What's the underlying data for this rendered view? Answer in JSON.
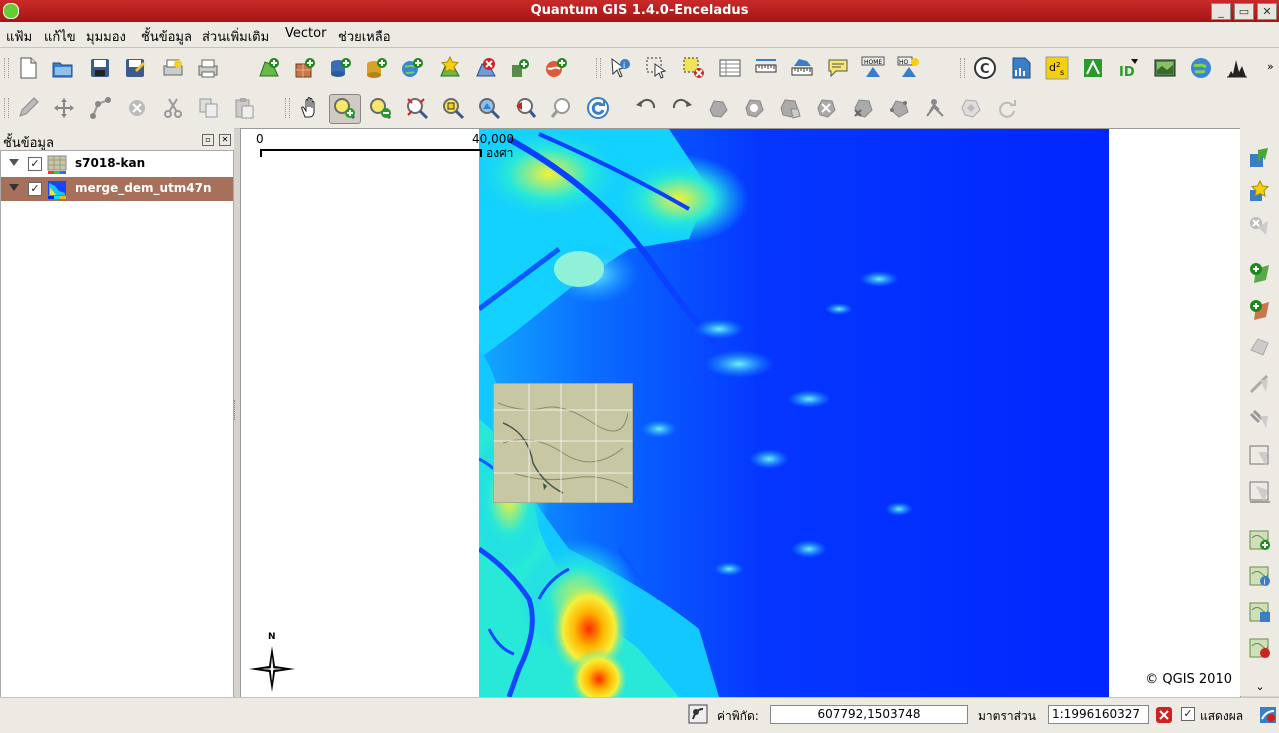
{
  "window": {
    "title": "Quantum GIS 1.4.0-Enceladus",
    "minimize": "_",
    "maximize": "▭",
    "close": "✕"
  },
  "menu": [
    "แฟ้ม",
    "แก้ไข",
    "มุมมอง",
    "ชั้นข้อมูล",
    "ส่วนเพิ่มเติม",
    "Vector",
    "ช่วยเหลือ"
  ],
  "layers_panel": {
    "title": "ชั้นข้อมูล",
    "layers": [
      {
        "name": "s7018-kan",
        "checked": "✓"
      },
      {
        "name": "merge_dem_utm47n",
        "checked": "✓"
      }
    ]
  },
  "map": {
    "scalebar_start": "0",
    "scalebar_end": "40,000",
    "scalebar_unit": "องศา",
    "north_label": "N",
    "copyright": "© QGIS 2010"
  },
  "toolbar_icons": {
    "row1": [
      "new-project-icon",
      "open-project-icon",
      "save-project-icon",
      "save-as-icon",
      "print-composer-icon",
      "print-icon",
      "add-vector-layer-icon",
      "add-raster-layer-icon",
      "add-postgis-layer-icon",
      "add-spatialite-layer-icon",
      "add-wms-layer-icon",
      "new-vector-layer-icon",
      "remove-layer-icon",
      "overview-add-icon",
      "add-wfs-layer-icon",
      "identify-icon",
      "select-features-icon",
      "deselect-icon",
      "attribute-table-icon",
      "measure-line-icon",
      "measure-area-icon",
      "map-tips-icon",
      "home-icon",
      "ho-icon",
      "copyright-icon",
      "export-icon",
      "d2s-icon",
      "georeferencer-icon",
      "gps-icon",
      "raster-icon",
      "globe-icon",
      "histogram-icon"
    ],
    "row2": [
      "toggle-edit-icon",
      "move-feature-icon",
      "node-tool-icon",
      "delete-feature-icon",
      "cut-icon",
      "copy-icon",
      "paste-icon",
      "pan-icon",
      "zoom-in-icon",
      "zoom-out-icon",
      "zoom-full-icon",
      "zoom-selection-icon",
      "zoom-layer-icon",
      "zoom-last-icon",
      "zoom-next-icon",
      "refresh-icon",
      "undo-icon",
      "redo-icon",
      "simplify-icon",
      "add-ring-icon",
      "add-island-icon",
      "delete-ring-icon",
      "delete-part-icon",
      "reshape-icon",
      "split-icon",
      "merge-icon",
      "rotate-icon"
    ]
  },
  "right_toolbar": [
    "add-vector-side-icon",
    "add-raster-side-icon",
    "remove-side-icon",
    "new-layer-side-icon",
    "add-layer-side-icon",
    "edit-side-icon",
    "digitize-side-icon",
    "move-side-icon",
    "node-side-icon",
    "tool-side-icon",
    "map-add-icon",
    "map-info-icon",
    "map-export-icon",
    "map-delete-icon",
    "more-icon"
  ],
  "status": {
    "coord_label": "ค่าพิกัด:",
    "coord_value": "607792,1503748",
    "scale_label": "มาตราส่วน",
    "scale_value": "1:1996160327",
    "render_label": "แสดงผล",
    "render_checked": "✓"
  },
  "colors": {
    "title_bar": "#b11d1d",
    "selection": "#a7705a",
    "dem_low": "#0026ff",
    "dem_mid": "#00e5ff",
    "dem_high": "#ff2a00"
  }
}
